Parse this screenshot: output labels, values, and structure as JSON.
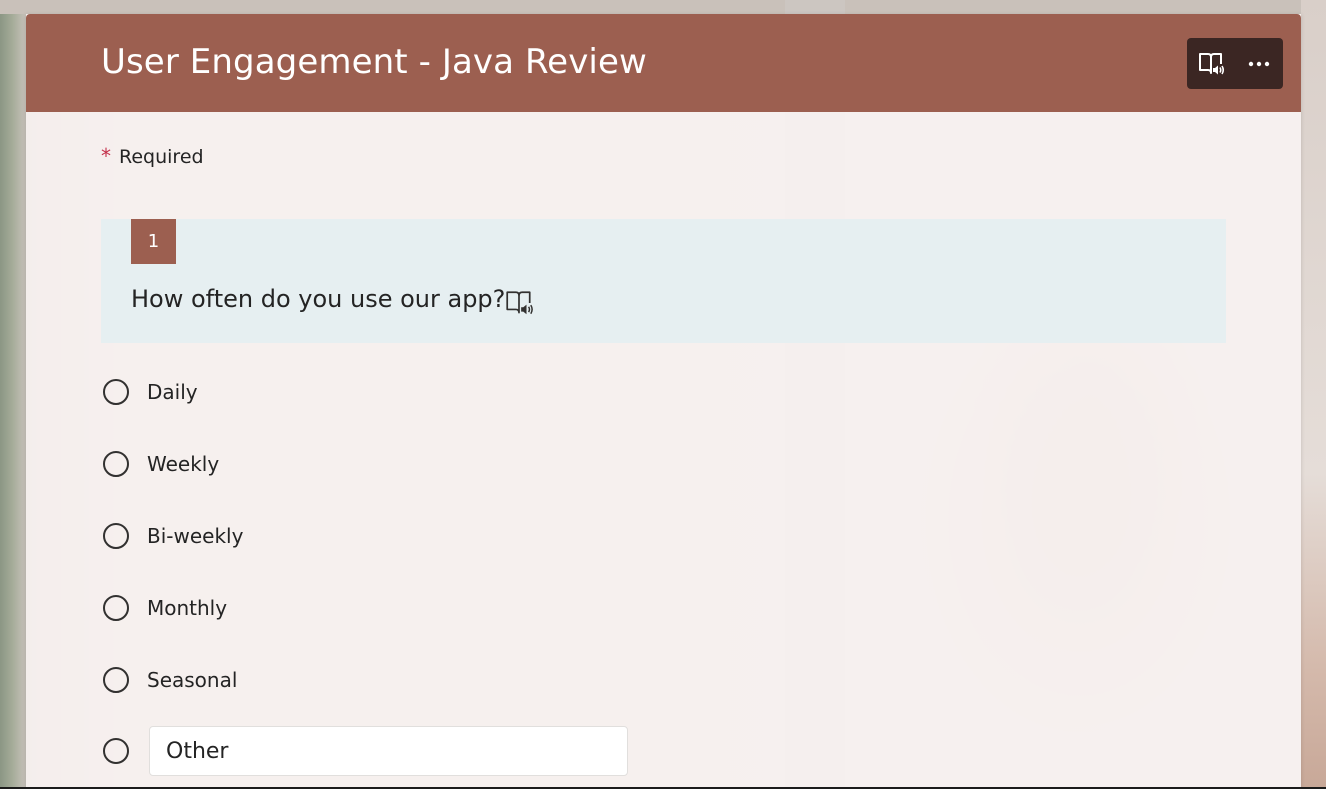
{
  "form": {
    "title": "User Engagement - Java Review",
    "required_label": "Required",
    "required_marker": "*"
  },
  "header_tools": {
    "reader_icon": "immersive-reader-icon",
    "more_icon": "more-options-icon"
  },
  "question": {
    "number": "1",
    "text": "How often do you use our app?",
    "reader_icon": "immersive-reader-icon",
    "options": [
      {
        "label": "Daily"
      },
      {
        "label": "Weekly"
      },
      {
        "label": "Bi-weekly"
      },
      {
        "label": "Monthly"
      },
      {
        "label": "Seasonal"
      }
    ],
    "other": {
      "placeholder": "Other",
      "value": ""
    }
  },
  "colors": {
    "accent": "#9c5f50",
    "tools_bg": "#3b2623",
    "question_bg": "#e6eff1",
    "required_star": "#c4314b"
  }
}
